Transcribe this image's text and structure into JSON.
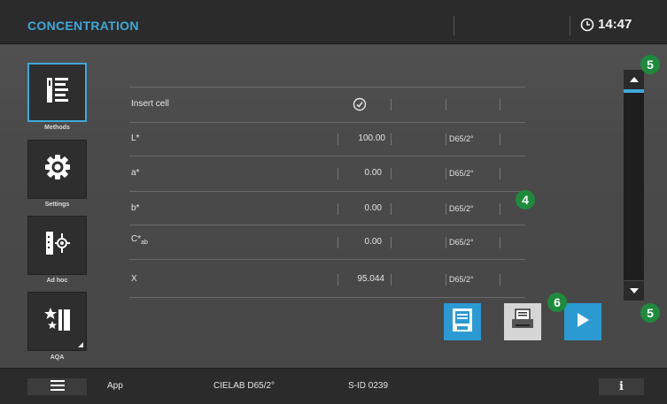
{
  "header": {
    "title": "CONCENTRATION",
    "time": "14:47"
  },
  "sidebar": {
    "items": [
      {
        "label": "Methods",
        "icon": "methods-list-icon",
        "active": true
      },
      {
        "label": "Settings",
        "icon": "gear-icon",
        "active": false
      },
      {
        "label": "Ad hoc",
        "icon": "ad-hoc-measure-icon",
        "active": false
      },
      {
        "label": "AQA",
        "icon": "aqa-stars-icon",
        "active": false
      }
    ]
  },
  "table": {
    "rows": [
      {
        "label": "Insert cell",
        "value": "",
        "illuminant": ""
      },
      {
        "label": "L*",
        "value": "100.00",
        "illuminant": "D65/2°"
      },
      {
        "label": "a*",
        "value": "0.00",
        "illuminant": "D65/2°"
      },
      {
        "label": "b*",
        "value": "0.00",
        "illuminant": "D65/2°"
      },
      {
        "label": "C*",
        "sub": "ab",
        "value": "0.00",
        "illuminant": "D65/2°"
      },
      {
        "label": "X",
        "value": "95.044",
        "illuminant": "D65/2°"
      }
    ]
  },
  "badges": {
    "table": "4",
    "scroll_up": "5",
    "scroll_down": "5",
    "actions": "6"
  },
  "footer": {
    "app": "App",
    "color_space": "CIELAB D65/2°",
    "sid": "S-ID 0239",
    "info": "i"
  },
  "colors": {
    "accent": "#3fa9d8",
    "badge": "#1e8a3c",
    "topbar": "#2b2b2b",
    "background": "#4a4a4a"
  }
}
